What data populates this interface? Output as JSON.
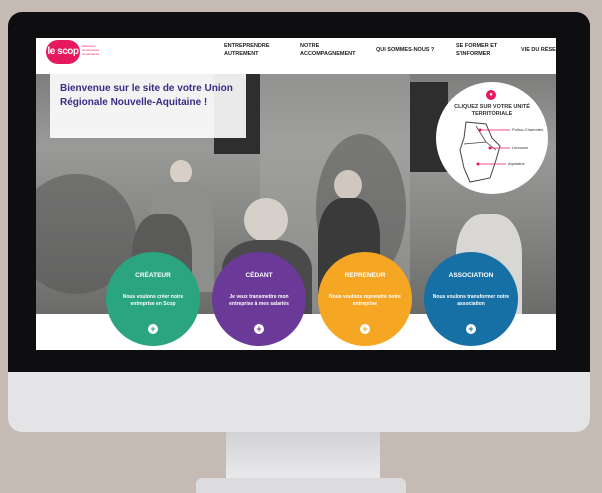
{
  "site": {
    "logo": "le scop",
    "logo_subtitle": "bâtisseurs d'entreprises coopératives",
    "colors": {
      "brand": "#e6185e",
      "purple": "#3c2a86"
    }
  },
  "nav": {
    "items": [
      {
        "label": "ENTREPRENDRE AUTREMENT"
      },
      {
        "label": "NOTRE ACCOMPAGNEMENT"
      },
      {
        "label": "QUI SOMMES-NOUS ?"
      },
      {
        "label": "SE FORMER ET S'INFORMER"
      },
      {
        "label": "VIE DU RÉSEAU"
      }
    ]
  },
  "hero": {
    "welcome": "Bienvenue sur le site de votre Union Régionale Nouvelle-Aquitaine !"
  },
  "map": {
    "title": "CLIQUEZ SUR VOTRE UNITÉ TERRITORIALE",
    "regions": [
      "Poitou-Charentes",
      "Limousin",
      "Aquitaine"
    ],
    "pin_icon": "location-icon"
  },
  "categories": [
    {
      "title": "CRÉATEUR",
      "text": "Nous voulons créer notre entreprise en Scop",
      "color": "#2aa57f"
    },
    {
      "title": "CÉDANT",
      "text": "Je veux transmettre mon entreprise à mes salariés",
      "color": "#6b3a98"
    },
    {
      "title": "REPRENEUR",
      "text": "Nous voulons reprendre notre entreprise",
      "color": "#f5a623"
    },
    {
      "title": "ASSOCIATION",
      "text": "Nous voulons transformer notre association",
      "color": "#1670a6"
    }
  ]
}
